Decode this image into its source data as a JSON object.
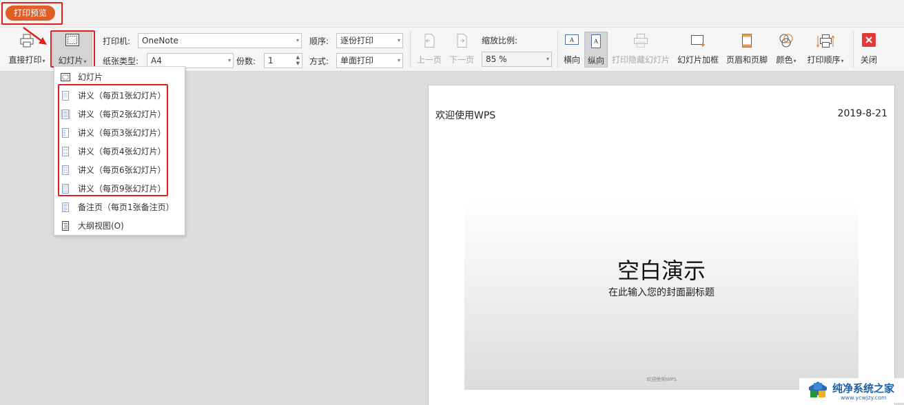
{
  "tabs": {
    "print_preview": "打印预览"
  },
  "toolbar": {
    "direct_print": "直接打印",
    "slides_button": "幻灯片",
    "printer_label": "打印机:",
    "printer_value": "OneNote",
    "paper_label": "纸张类型:",
    "paper_value": "A4",
    "copies_label": "份数:",
    "copies_value": "1",
    "order_label": "顺序:",
    "order_value": "逐份打印",
    "mode_label": "方式:",
    "mode_value": "单面打印",
    "prev_page": "上一页",
    "next_page": "下一页",
    "zoom_label": "缩放比例:",
    "zoom_value": "85 %",
    "landscape": "横向",
    "portrait": "纵向",
    "print_hidden": "打印隐藏幻灯片",
    "slide_frame": "幻灯片加框",
    "header_footer": "页眉和页脚",
    "color": "颜色",
    "print_order": "打印顺序",
    "close": "关闭"
  },
  "menu": {
    "items": [
      "幻灯片",
      "讲义（每页1张幻灯片）",
      "讲义（每页2张幻灯片）",
      "讲义（每页3张幻灯片）",
      "讲义（每页4张幻灯片）",
      "讲义（每页6张幻灯片）",
      "讲义（每页9张幻灯片）",
      "备注页（每页1张备注页）",
      "大纲视图(O)"
    ]
  },
  "preview": {
    "header_left": "欢迎使用WPS",
    "header_right": "2019-8-21",
    "slide_title": "空白演示",
    "slide_subtitle": "在此输入您的封面副标题",
    "slide_footer": "欢迎使用WPS"
  },
  "watermark": {
    "text": "纯净系统之家",
    "url": "www.ycwjzy.com"
  },
  "colors": {
    "accent": "#e05f28",
    "highlight_box": "#e02020",
    "watermark": "#1b5fa7"
  }
}
